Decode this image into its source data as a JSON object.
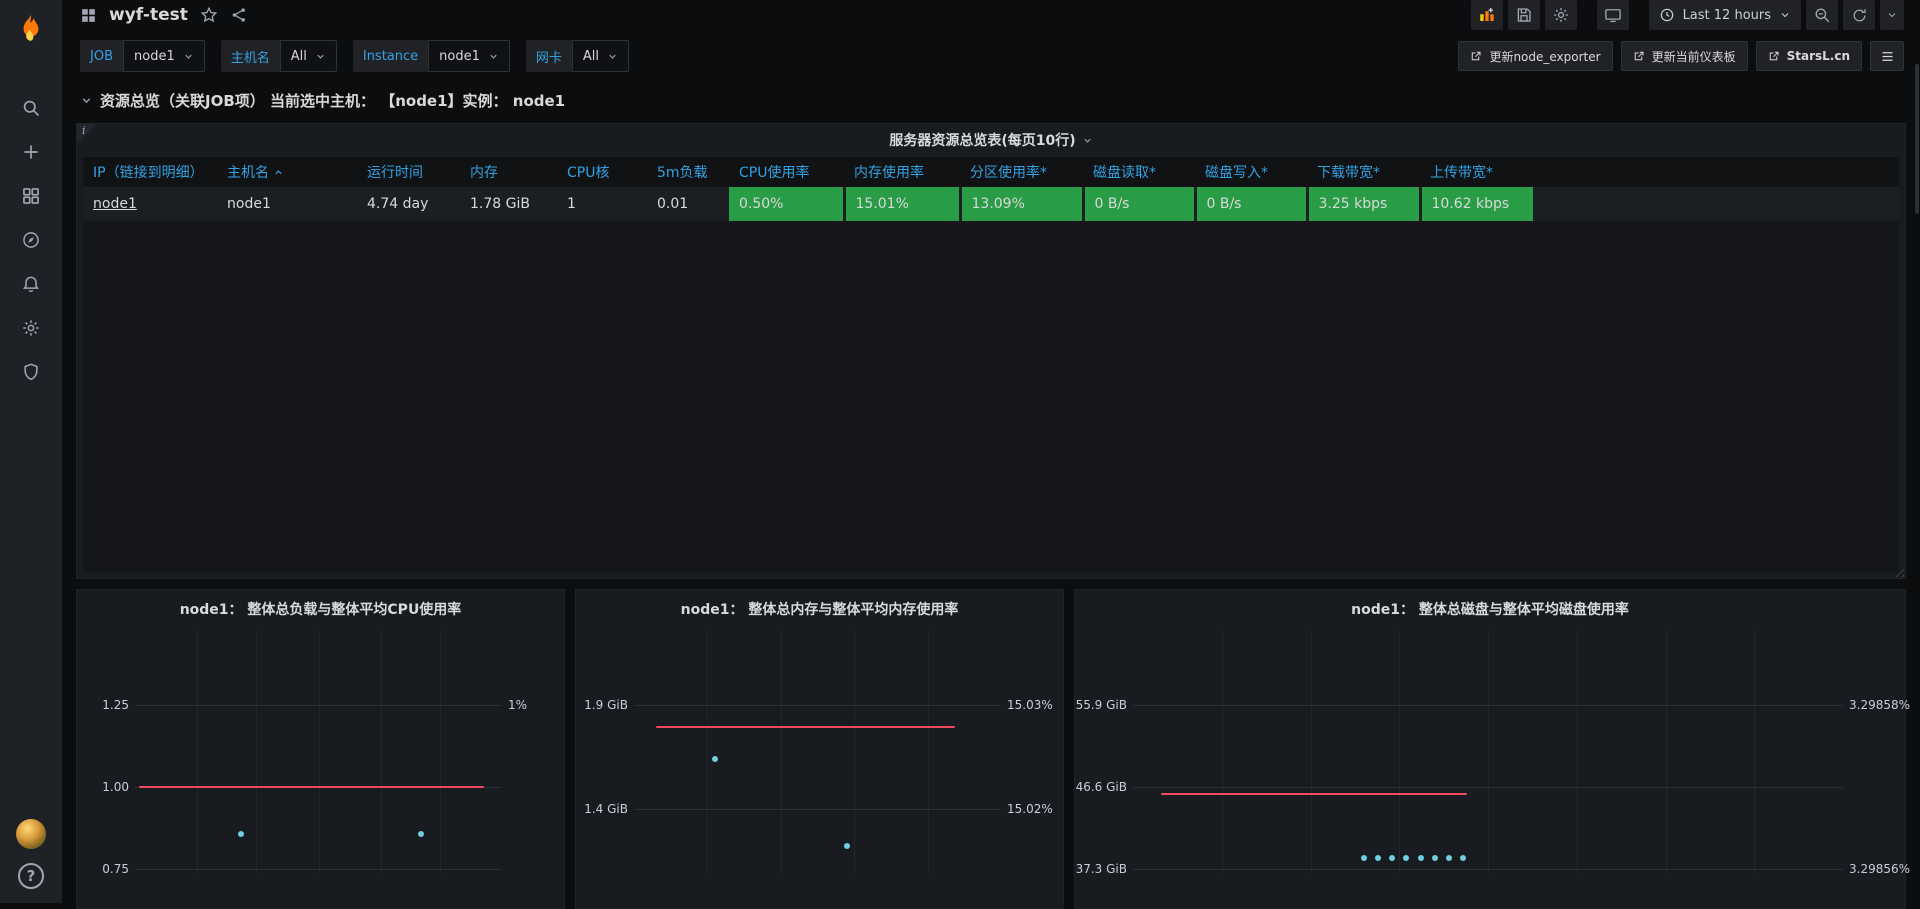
{
  "colors": {
    "accent_blue": "#33a2e5",
    "status_green": "#299c46",
    "series_red": "#f2495c",
    "series_cyan": "#6ed0e0",
    "logo_orange": "#ff780a"
  },
  "sidebar": {
    "items": [
      "search",
      "create",
      "dashboards",
      "explore",
      "alerting",
      "configuration",
      "server-admin"
    ],
    "help_glyph": "?"
  },
  "header": {
    "title": "wyf-test",
    "time_range_label": "Last 12 hours"
  },
  "submenu": {
    "variables": [
      {
        "label": "JOB",
        "value": "node1"
      },
      {
        "label": "主机名",
        "value": "All"
      },
      {
        "label": "Instance",
        "value": "node1"
      },
      {
        "label": "网卡",
        "value": "All"
      }
    ],
    "links": [
      {
        "label": "更新node_exporter"
      },
      {
        "label": "更新当前仪表板"
      },
      {
        "label": "StarsL.cn"
      }
    ]
  },
  "row_header": {
    "title": "资源总览（关联JOB项） 当前选中主机： 【node1】实例： node1"
  },
  "table_panel": {
    "title": "服务器资源总览表(每页10行)",
    "info_glyph": "i",
    "sorted_column": "主机名",
    "columns": [
      "IP（链接到明细）",
      "主机名",
      "运行时间",
      "内存",
      "CPU核",
      "5m负载",
      "CPU使用率",
      "内存使用率",
      "分区使用率*",
      "磁盘读取*",
      "磁盘写入*",
      "下载带宽*",
      "上传带宽*"
    ],
    "rows": [
      [
        "node1",
        "node1",
        "4.74 day",
        "1.78 GiB",
        "1",
        "0.01",
        "0.50%",
        "15.01%",
        "13.09%",
        "0 B/s",
        "0 B/s",
        "3.25 kbps",
        "10.62 kbps"
      ]
    ]
  },
  "chart_data": [
    {
      "type": "line",
      "title": "node1： 整体总负载与整体平均CPU使用率",
      "left_axis_ticks": [
        {
          "label": "1.25",
          "y": 0.31
        },
        {
          "label": "1.00",
          "y": 0.645
        },
        {
          "label": "0.75",
          "y": 0.985
        }
      ],
      "right_axis_ticks": [
        {
          "label": "1%",
          "y": 0.31
        }
      ],
      "line_series": {
        "color": "#f2495c",
        "approx_value": "1.00",
        "y": 0.645,
        "x1": 0.01,
        "x2": 0.95
      },
      "point_series": {
        "color": "#6ed0e0",
        "points": [
          [
            0.29,
            0.84
          ],
          [
            0.78,
            0.84
          ]
        ]
      },
      "grid_x": [
        0.17,
        0.33,
        0.5,
        0.67,
        0.83
      ]
    },
    {
      "type": "line",
      "title": "node1： 整体总内存与整体平均内存使用率",
      "left_axis_ticks": [
        {
          "label": "1.9 GiB",
          "y": 0.31
        },
        {
          "label": "1.4 GiB",
          "y": 0.735
        }
      ],
      "right_axis_ticks": [
        {
          "label": "15.03%",
          "y": 0.31
        },
        {
          "label": "15.02%",
          "y": 0.735
        }
      ],
      "line_series": {
        "color": "#f2495c",
        "approx_value": "1.87 GiB",
        "y": 0.4,
        "x1": 0.06,
        "x2": 0.875
      },
      "point_series": {
        "color": "#6ed0e0",
        "points": [
          [
            0.22,
            0.53
          ],
          [
            0.58,
            0.89
          ]
        ]
      },
      "grid_x": [
        0.2,
        0.4,
        0.6,
        0.8
      ]
    },
    {
      "type": "line",
      "title": "node1： 整体总磁盘与整体平均磁盘使用率",
      "left_axis_ticks": [
        {
          "label": "55.9 GiB",
          "y": 0.31
        },
        {
          "label": "46.6 GiB",
          "y": 0.645
        },
        {
          "label": "37.3 GiB",
          "y": 0.985
        }
      ],
      "right_axis_ticks": [
        {
          "label": "3.29858%",
          "y": 0.31
        },
        {
          "label": "3.29856%",
          "y": 0.985
        }
      ],
      "line_series": {
        "color": "#f2495c",
        "approx_value": "47 GiB",
        "y": 0.675,
        "x1": 0.04,
        "x2": 0.47
      },
      "point_series": {
        "color": "#6ed0e0",
        "points": [
          [
            0.325,
            0.94
          ],
          [
            0.345,
            0.94
          ],
          [
            0.365,
            0.94
          ],
          [
            0.385,
            0.94
          ],
          [
            0.405,
            0.94
          ],
          [
            0.425,
            0.94
          ],
          [
            0.445,
            0.94
          ],
          [
            0.465,
            0.94
          ]
        ]
      },
      "grid_x": [
        0.125,
        0.25,
        0.375,
        0.5,
        0.625,
        0.75,
        0.875
      ]
    }
  ]
}
